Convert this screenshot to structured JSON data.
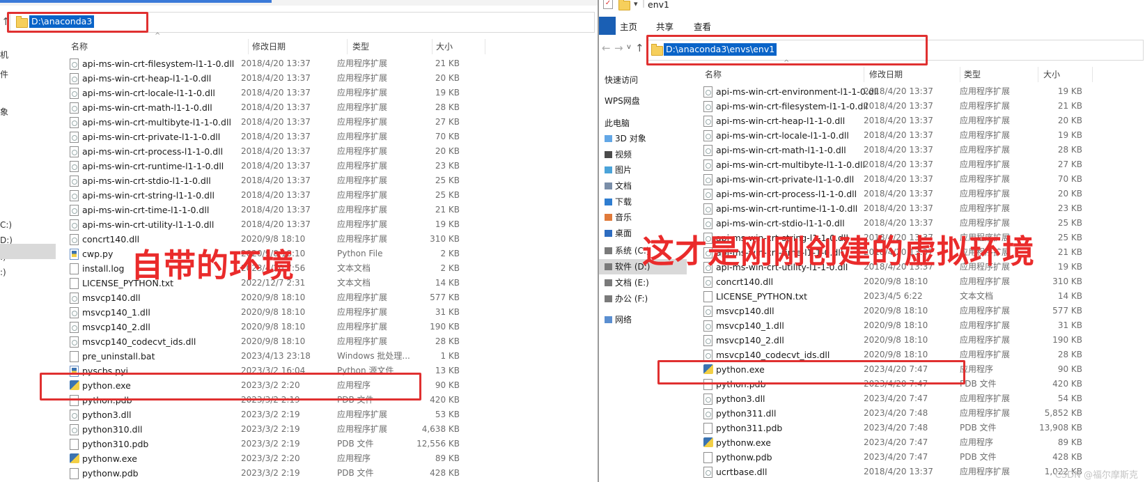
{
  "left": {
    "address": "D:\\anaconda3",
    "columns": {
      "name": "名称",
      "date": "修改日期",
      "type": "类型",
      "size": "大小"
    },
    "sidebar_fragments": [
      "机",
      "件",
      "象",
      "C:)",
      "D:)",
      ":)",
      ":)"
    ],
    "files": [
      {
        "name": "api-ms-win-crt-filesystem-l1-1-0.dll",
        "date": "2018/4/20 13:37",
        "type": "应用程序扩展",
        "size": "21 KB",
        "icon": "dll"
      },
      {
        "name": "api-ms-win-crt-heap-l1-1-0.dll",
        "date": "2018/4/20 13:37",
        "type": "应用程序扩展",
        "size": "20 KB",
        "icon": "dll"
      },
      {
        "name": "api-ms-win-crt-locale-l1-1-0.dll",
        "date": "2018/4/20 13:37",
        "type": "应用程序扩展",
        "size": "19 KB",
        "icon": "dll"
      },
      {
        "name": "api-ms-win-crt-math-l1-1-0.dll",
        "date": "2018/4/20 13:37",
        "type": "应用程序扩展",
        "size": "28 KB",
        "icon": "dll"
      },
      {
        "name": "api-ms-win-crt-multibyte-l1-1-0.dll",
        "date": "2018/4/20 13:37",
        "type": "应用程序扩展",
        "size": "27 KB",
        "icon": "dll"
      },
      {
        "name": "api-ms-win-crt-private-l1-1-0.dll",
        "date": "2018/4/20 13:37",
        "type": "应用程序扩展",
        "size": "70 KB",
        "icon": "dll"
      },
      {
        "name": "api-ms-win-crt-process-l1-1-0.dll",
        "date": "2018/4/20 13:37",
        "type": "应用程序扩展",
        "size": "20 KB",
        "icon": "dll"
      },
      {
        "name": "api-ms-win-crt-runtime-l1-1-0.dll",
        "date": "2018/4/20 13:37",
        "type": "应用程序扩展",
        "size": "23 KB",
        "icon": "dll"
      },
      {
        "name": "api-ms-win-crt-stdio-l1-1-0.dll",
        "date": "2018/4/20 13:37",
        "type": "应用程序扩展",
        "size": "25 KB",
        "icon": "dll"
      },
      {
        "name": "api-ms-win-crt-string-l1-1-0.dll",
        "date": "2018/4/20 13:37",
        "type": "应用程序扩展",
        "size": "25 KB",
        "icon": "dll"
      },
      {
        "name": "api-ms-win-crt-time-l1-1-0.dll",
        "date": "2018/4/20 13:37",
        "type": "应用程序扩展",
        "size": "21 KB",
        "icon": "dll"
      },
      {
        "name": "api-ms-win-crt-utility-l1-1-0.dll",
        "date": "2018/4/20 13:37",
        "type": "应用程序扩展",
        "size": "19 KB",
        "icon": "dll"
      },
      {
        "name": "concrt140.dll",
        "date": "2020/9/8 18:10",
        "type": "应用程序扩展",
        "size": "310 KB",
        "icon": "dll"
      },
      {
        "name": "cwp.py",
        "date": "2020/9/8 18:10",
        "type": "Python File",
        "size": "2 KB",
        "icon": "py"
      },
      {
        "name": "install.log",
        "date": "2023/4/20 7:56",
        "type": "文本文档",
        "size": "2 KB",
        "icon": "doc"
      },
      {
        "name": "LICENSE_PYTHON.txt",
        "date": "2022/12/7 2:31",
        "type": "文本文档",
        "size": "14 KB",
        "icon": "doc"
      },
      {
        "name": "msvcp140.dll",
        "date": "2020/9/8 18:10",
        "type": "应用程序扩展",
        "size": "577 KB",
        "icon": "dll"
      },
      {
        "name": "msvcp140_1.dll",
        "date": "2020/9/8 18:10",
        "type": "应用程序扩展",
        "size": "31 KB",
        "icon": "dll"
      },
      {
        "name": "msvcp140_2.dll",
        "date": "2020/9/8 18:10",
        "type": "应用程序扩展",
        "size": "190 KB",
        "icon": "dll"
      },
      {
        "name": "msvcp140_codecvt_ids.dll",
        "date": "2020/9/8 18:10",
        "type": "应用程序扩展",
        "size": "28 KB",
        "icon": "dll"
      },
      {
        "name": "pre_uninstall.bat",
        "date": "2023/4/13 23:18",
        "type": "Windows 批处理...",
        "size": "1 KB",
        "icon": "doc"
      },
      {
        "name": "pyscbs.pyi",
        "date": "2023/3/2 16:04",
        "type": "Python 源文件",
        "size": "13 KB",
        "icon": "py"
      },
      {
        "name": "python.exe",
        "date": "2023/3/2 2:20",
        "type": "应用程序",
        "size": "90 KB",
        "icon": "exe"
      },
      {
        "name": "python.pdb",
        "date": "2023/3/2 2:19",
        "type": "PDB 文件",
        "size": "420 KB",
        "icon": "doc"
      },
      {
        "name": "python3.dll",
        "date": "2023/3/2 2:19",
        "type": "应用程序扩展",
        "size": "53 KB",
        "icon": "dll"
      },
      {
        "name": "python310.dll",
        "date": "2023/3/2 2:19",
        "type": "应用程序扩展",
        "size": "4,638 KB",
        "icon": "dll"
      },
      {
        "name": "python310.pdb",
        "date": "2023/3/2 2:19",
        "type": "PDB 文件",
        "size": "12,556 KB",
        "icon": "doc"
      },
      {
        "name": "pythonw.exe",
        "date": "2023/3/2 2:20",
        "type": "应用程序",
        "size": "89 KB",
        "icon": "exe"
      },
      {
        "name": "pythonw.pdb",
        "date": "2023/3/2 2:19",
        "type": "PDB 文件",
        "size": "428 KB",
        "icon": "doc"
      }
    ],
    "annotation": "自带的环境"
  },
  "right": {
    "title": "env1",
    "ribbon_tabs": [
      "主页",
      "共享",
      "查看"
    ],
    "address": "D:\\anaconda3\\envs\\env1",
    "columns": {
      "name": "名称",
      "date": "修改日期",
      "type": "类型",
      "size": "大小"
    },
    "sidebar": [
      {
        "label": "快速访问",
        "icon": "star-icon"
      },
      {
        "label": "WPS网盘",
        "icon": "cloud-icon"
      },
      {
        "label": "此电脑",
        "icon": "computer-icon"
      },
      {
        "label": "3D 对象",
        "icon": "cube-icon"
      },
      {
        "label": "视频",
        "icon": "video-icon"
      },
      {
        "label": "图片",
        "icon": "picture-icon"
      },
      {
        "label": "文档",
        "icon": "document-icon"
      },
      {
        "label": "下载",
        "icon": "download-icon"
      },
      {
        "label": "音乐",
        "icon": "music-icon"
      },
      {
        "label": "桌面",
        "icon": "desktop-icon"
      },
      {
        "label": "系统 (C:)",
        "icon": "drive-icon"
      },
      {
        "label": "软件 (D:)",
        "icon": "drive-icon",
        "selected": true
      },
      {
        "label": "文档 (E:)",
        "icon": "drive-icon"
      },
      {
        "label": "办公 (F:)",
        "icon": "drive-icon"
      },
      {
        "label": "网络",
        "icon": "network-icon"
      }
    ],
    "files": [
      {
        "name": "api-ms-win-crt-environment-l1-1-0.dll",
        "date": "2018/4/20 13:37",
        "type": "应用程序扩展",
        "size": "19 KB",
        "icon": "dll"
      },
      {
        "name": "api-ms-win-crt-filesystem-l1-1-0.dll",
        "date": "2018/4/20 13:37",
        "type": "应用程序扩展",
        "size": "21 KB",
        "icon": "dll"
      },
      {
        "name": "api-ms-win-crt-heap-l1-1-0.dll",
        "date": "2018/4/20 13:37",
        "type": "应用程序扩展",
        "size": "20 KB",
        "icon": "dll"
      },
      {
        "name": "api-ms-win-crt-locale-l1-1-0.dll",
        "date": "2018/4/20 13:37",
        "type": "应用程序扩展",
        "size": "19 KB",
        "icon": "dll"
      },
      {
        "name": "api-ms-win-crt-math-l1-1-0.dll",
        "date": "2018/4/20 13:37",
        "type": "应用程序扩展",
        "size": "28 KB",
        "icon": "dll"
      },
      {
        "name": "api-ms-win-crt-multibyte-l1-1-0.dll",
        "date": "2018/4/20 13:37",
        "type": "应用程序扩展",
        "size": "27 KB",
        "icon": "dll"
      },
      {
        "name": "api-ms-win-crt-private-l1-1-0.dll",
        "date": "2018/4/20 13:37",
        "type": "应用程序扩展",
        "size": "70 KB",
        "icon": "dll"
      },
      {
        "name": "api-ms-win-crt-process-l1-1-0.dll",
        "date": "2018/4/20 13:37",
        "type": "应用程序扩展",
        "size": "20 KB",
        "icon": "dll"
      },
      {
        "name": "api-ms-win-crt-runtime-l1-1-0.dll",
        "date": "2018/4/20 13:37",
        "type": "应用程序扩展",
        "size": "23 KB",
        "icon": "dll"
      },
      {
        "name": "api-ms-win-crt-stdio-l1-1-0.dll",
        "date": "2018/4/20 13:37",
        "type": "应用程序扩展",
        "size": "25 KB",
        "icon": "dll"
      },
      {
        "name": "api-ms-win-crt-string-l1-1-0.dll",
        "date": "2018/4/20 13:37",
        "type": "应用程序扩展",
        "size": "25 KB",
        "icon": "dll"
      },
      {
        "name": "api-ms-win-crt-time-l1-1-0.dll",
        "date": "2018/4/20 13:37",
        "type": "应用程序扩展",
        "size": "21 KB",
        "icon": "dll"
      },
      {
        "name": "api-ms-win-crt-utility-l1-1-0.dll",
        "date": "2018/4/20 13:37",
        "type": "应用程序扩展",
        "size": "19 KB",
        "icon": "dll"
      },
      {
        "name": "concrt140.dll",
        "date": "2020/9/8 18:10",
        "type": "应用程序扩展",
        "size": "310 KB",
        "icon": "dll"
      },
      {
        "name": "LICENSE_PYTHON.txt",
        "date": "2023/4/5 6:22",
        "type": "文本文档",
        "size": "14 KB",
        "icon": "doc"
      },
      {
        "name": "msvcp140.dll",
        "date": "2020/9/8 18:10",
        "type": "应用程序扩展",
        "size": "577 KB",
        "icon": "dll"
      },
      {
        "name": "msvcp140_1.dll",
        "date": "2020/9/8 18:10",
        "type": "应用程序扩展",
        "size": "31 KB",
        "icon": "dll"
      },
      {
        "name": "msvcp140_2.dll",
        "date": "2020/9/8 18:10",
        "type": "应用程序扩展",
        "size": "190 KB",
        "icon": "dll"
      },
      {
        "name": "msvcp140_codecvt_ids.dll",
        "date": "2020/9/8 18:10",
        "type": "应用程序扩展",
        "size": "28 KB",
        "icon": "dll"
      },
      {
        "name": "python.exe",
        "date": "2023/4/20 7:47",
        "type": "应用程序",
        "size": "90 KB",
        "icon": "exe"
      },
      {
        "name": "python.pdb",
        "date": "2023/4/20 7:47",
        "type": "PDB 文件",
        "size": "420 KB",
        "icon": "doc"
      },
      {
        "name": "python3.dll",
        "date": "2023/4/20 7:47",
        "type": "应用程序扩展",
        "size": "54 KB",
        "icon": "dll"
      },
      {
        "name": "python311.dll",
        "date": "2023/4/20 7:48",
        "type": "应用程序扩展",
        "size": "5,852 KB",
        "icon": "dll"
      },
      {
        "name": "python311.pdb",
        "date": "2023/4/20 7:48",
        "type": "PDB 文件",
        "size": "13,908 KB",
        "icon": "doc"
      },
      {
        "name": "pythonw.exe",
        "date": "2023/4/20 7:47",
        "type": "应用程序",
        "size": "89 KB",
        "icon": "exe"
      },
      {
        "name": "pythonw.pdb",
        "date": "2023/4/20 7:47",
        "type": "PDB 文件",
        "size": "428 KB",
        "icon": "doc"
      },
      {
        "name": "ucrtbase.dll",
        "date": "2018/4/20 13:37",
        "type": "应用程序扩展",
        "size": "1,022 KB",
        "icon": "dll"
      }
    ],
    "annotation": "这才是刚刚创建的虚拟环境"
  },
  "watermark": "CSDN @福尔摩斯克",
  "colors": {
    "annotation": "#ea2b2b",
    "selection": "#0a64c8",
    "folder": "#f6cf5c"
  }
}
